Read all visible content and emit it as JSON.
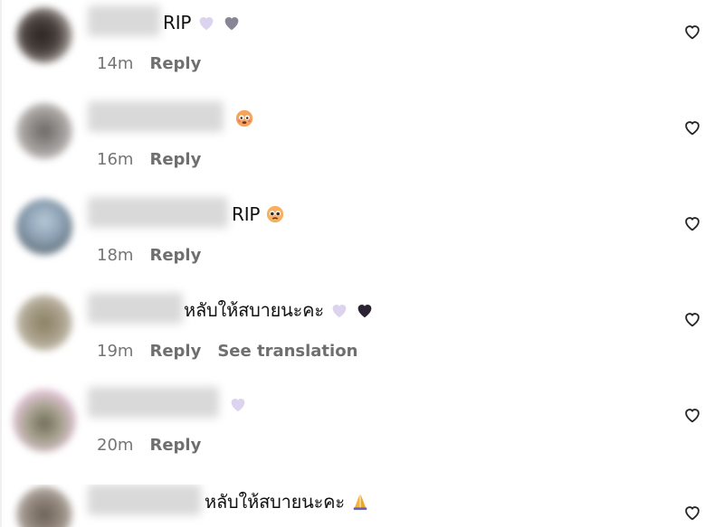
{
  "comments": [
    {
      "text": "RIP",
      "emojis": [
        "light-purple-heart",
        "grey-heart"
      ],
      "time": "14m",
      "actions": [
        "Reply"
      ]
    },
    {
      "text": "",
      "emojis": [
        "flushed-face"
      ],
      "time": "16m",
      "actions": [
        "Reply"
      ]
    },
    {
      "text": "RIP",
      "emojis": [
        "pleading-face"
      ],
      "time": "18m",
      "actions": [
        "Reply"
      ]
    },
    {
      "text": "หลับให้สบายนะคะ",
      "emojis": [
        "light-purple-heart",
        "black-heart"
      ],
      "time": "19m",
      "actions": [
        "Reply",
        "See translation"
      ]
    },
    {
      "text": "",
      "emojis": [
        "light-purple-heart"
      ],
      "time": "20m",
      "actions": [
        "Reply"
      ]
    },
    {
      "text": "หลับให้สบายนะคะ",
      "emojis": [
        "folded-hands"
      ],
      "time": "",
      "actions": []
    }
  ],
  "colors": {
    "meta_text": "#757575",
    "heart_outline": "#262626"
  }
}
